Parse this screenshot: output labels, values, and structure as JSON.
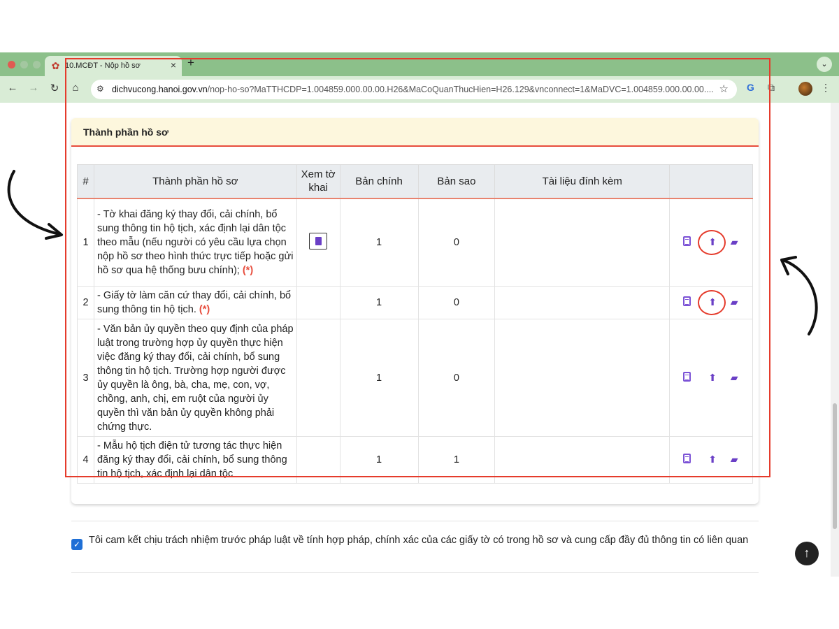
{
  "browser": {
    "tab_title": "10.MCĐT - Nộp hồ sơ",
    "tab_close": "×",
    "new_tab": "+",
    "url_host": "dichvucong.hanoi.gov.vn",
    "url_path": "/nop-ho-so?MaTTHCDP=1.004859.000.00.00.H26&MaCoQuanThucHien=H26.129&vnconnect=1&MaDVC=1.004859.000.00.00....",
    "icons": [
      "back-arrow-icon",
      "forward-arrow-icon",
      "reload-icon",
      "home-icon",
      "site-info-icon",
      "bookmark-star-icon",
      "translate-icon",
      "extensions-icon",
      "profile-avatar",
      "menu-icon"
    ]
  },
  "card": {
    "title": "Thành phần hồ sơ"
  },
  "table": {
    "headers": {
      "idx": "#",
      "name": "Thành phần hồ sơ",
      "view": "Xem tờ khai",
      "original": "Bản chính",
      "copy": "Bản sao",
      "attachments": "Tài liệu đính kèm"
    },
    "rows": [
      {
        "idx": "1",
        "name": "- Tờ khai đăng ký thay đổi, cải chính, bổ sung thông tin hộ tịch, xác định lại dân tộc theo mẫu (nếu người có yêu cầu lựa chọn nộp hồ sơ theo hình thức trực tiếp hoặc gửi hồ sơ qua hệ thống bưu chính);",
        "required": "(*)",
        "original": "1",
        "copy": "0"
      },
      {
        "idx": "2",
        "name": "- Giấy tờ làm căn cứ thay đổi, cải chính, bổ sung thông tin hộ tịch.",
        "required": "(*)",
        "original": "1",
        "copy": "0"
      },
      {
        "idx": "3",
        "name": "- Văn bản ủy quyền theo quy định của pháp luật trong trường hợp ủy quyền thực hiện việc đăng ký thay đổi, cải chính, bổ sung thông tin hộ tịch. Trường hợp người được ủy quyền là ông, bà, cha, mẹ, con, vợ, chồng, anh, chị, em ruột của người ủy quyền thì văn bản ủy quyền không phải chứng thực.",
        "required": "",
        "original": "1",
        "copy": "0"
      },
      {
        "idx": "4",
        "name": "- Mẫu hộ tịch điện tử tương tác thực hiện đăng ký thay đổi, cải chính, bổ sung thông tin hộ tịch, xác định lại dân tộc",
        "required": "",
        "original": "1",
        "copy": "1"
      }
    ]
  },
  "commitment": {
    "checked": true,
    "text": "Tôi cam kết chịu trách nhiệm trước pháp luật về tính hợp pháp, chính xác của các giấy tờ có trong hồ sơ và cung cấp đầy đủ thông tin có liên quan"
  },
  "colors": {
    "highlight_red": "#e53b2c",
    "action_purple": "#6a3fc6",
    "header_bg": "#fdf7dd",
    "chrome_green": "#8cc08a"
  }
}
